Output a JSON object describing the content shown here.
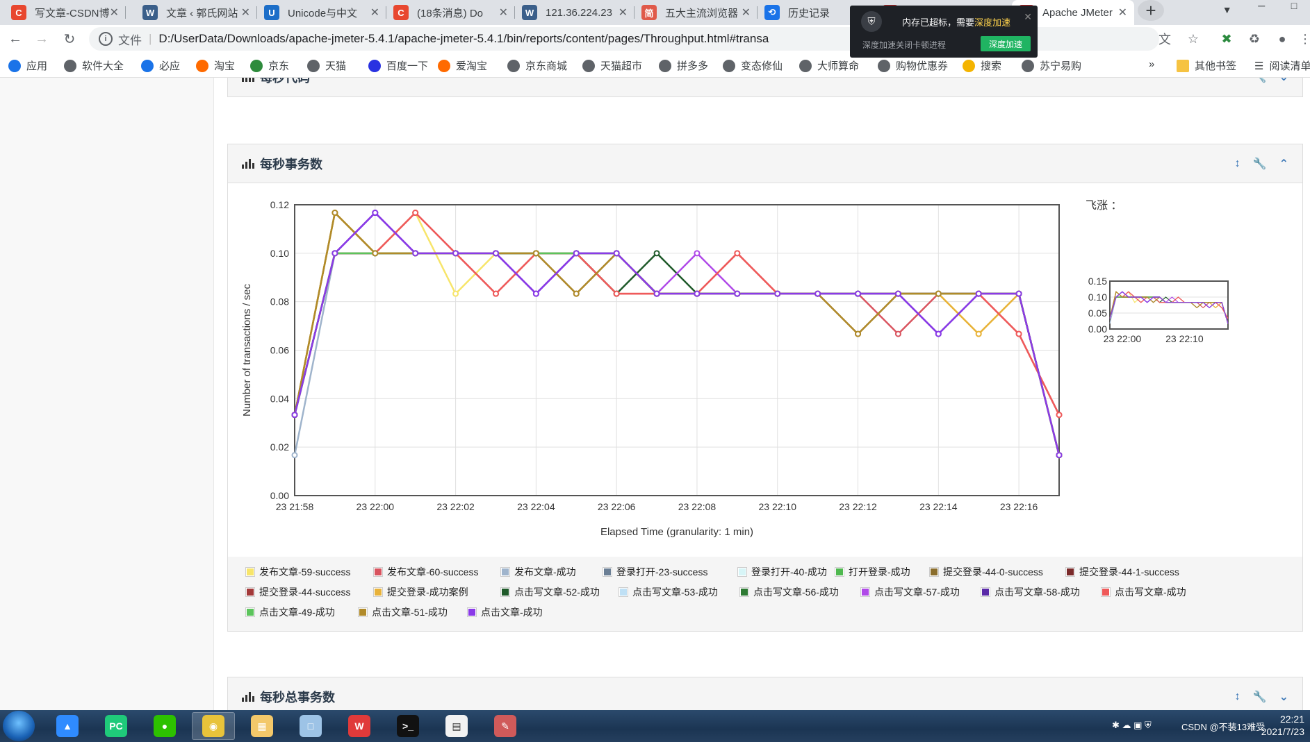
{
  "browser": {
    "tabs": [
      {
        "label": "写文章-CSDN博",
        "favicon": "C",
        "color": "#e8472f"
      },
      {
        "label": "文章 ‹ 郭氏网站",
        "favicon": "W",
        "color": "#3b5f8a"
      },
      {
        "label": "Unicode与中文",
        "favicon": "U",
        "color": "#1c6ec8"
      },
      {
        "label": "(18条消息) Do",
        "favicon": "C",
        "color": "#e8472f"
      },
      {
        "label": "121.36.224.23",
        "favicon": "W",
        "color": "#3b5f8a"
      },
      {
        "label": "五大主流浏览器",
        "favicon": "简",
        "color": "#e05a4a"
      },
      {
        "label": "历史记录",
        "favicon": "⟲",
        "color": "#1a73e8"
      },
      {
        "label": "Apache JMeter",
        "favicon": "/",
        "color": "#b22"
      },
      {
        "label": "Apache JMeter",
        "favicon": "/",
        "color": "#b22"
      }
    ],
    "address": {
      "scheme": "文件",
      "url": "D:/UserData/Downloads/apache-jmeter-5.4.1/apache-jmeter-5.4.1/bin/reports/content/pages/Throughput.html#transa"
    },
    "bookmarks": [
      {
        "label": "应用",
        "color": "#1a73e8"
      },
      {
        "label": "软件大全",
        "color": "#5f6368"
      },
      {
        "label": "必应",
        "color": "#1a73e8"
      },
      {
        "label": "淘宝",
        "color": "#ff6a00"
      },
      {
        "label": "京东",
        "color": "#2e8b3c"
      },
      {
        "label": "天猫",
        "color": "#5f6368"
      },
      {
        "label": "百度一下",
        "color": "#2932e1"
      },
      {
        "label": "爱淘宝",
        "color": "#ff6a00"
      },
      {
        "label": "京东商城",
        "color": "#5f6368"
      },
      {
        "label": "天猫超市",
        "color": "#5f6368"
      },
      {
        "label": "拼多多",
        "color": "#5f6368"
      },
      {
        "label": "变态修仙",
        "color": "#5f6368"
      },
      {
        "label": "大师算命",
        "color": "#5f6368"
      },
      {
        "label": "购物优惠券",
        "color": "#5f6368"
      },
      {
        "label": "搜索",
        "color": "#f4b400"
      },
      {
        "label": "苏宁易购",
        "color": "#5f6368"
      }
    ],
    "bookmarks_more": "»",
    "other_bookmarks": "其他书签",
    "reading_list": "阅读清单"
  },
  "popup": {
    "message": "内存已超标，需要",
    "highlight": "深度加速",
    "subtext": "深度加速关闭卡顿进程",
    "button": "深度加速"
  },
  "page": {
    "top_panel_title": "每秒代码",
    "main_panel_title": "每秒事务数",
    "bottom_panel_title": "每秒总事务数",
    "overview_title": "飞涨 ："
  },
  "chart_data": {
    "type": "line",
    "ylabel": "Number of transactions / sec",
    "xlabel": "Elapsed Time (granularity: 1 min)",
    "ylim": [
      0,
      0.12
    ],
    "yticks": [
      "0.00",
      "0.02",
      "0.04",
      "0.06",
      "0.08",
      "0.10",
      "0.12"
    ],
    "x": [
      "23 21:58",
      "23 21:59",
      "23 22:00",
      "23 22:01",
      "23 22:02",
      "23 22:03",
      "23 22:04",
      "23 22:05",
      "23 22:06",
      "23 22:07",
      "23 22:08",
      "23 22:09",
      "23 22:10",
      "23 22:11",
      "23 22:12",
      "23 22:13",
      "23 22:14",
      "23 22:15",
      "23 22:16",
      "23 22:17"
    ],
    "xticks": [
      "23 21:58",
      "23 22:00",
      "23 22:02",
      "23 22:04",
      "23 22:06",
      "23 22:08",
      "23 22:10",
      "23 22:12",
      "23 22:14",
      "23 22:16"
    ],
    "grid": true,
    "series": [
      {
        "name": "发布文章-59-success",
        "color": "#f7e56a",
        "values": [
          0.0333,
          0.1167,
          0.1,
          0.1167,
          0.0833,
          0.1,
          0.1,
          0.1,
          0.1,
          0.0833,
          0.0833,
          0.0833,
          0.0833,
          0.0833,
          0.0833,
          0.0833,
          0.0833,
          0.0667,
          0.0833,
          0.0167
        ]
      },
      {
        "name": "发布文章-60-success",
        "color": "#d9545f",
        "values": [
          0.0333,
          0.1,
          0.1,
          0.1167,
          0.1,
          0.0833,
          0.1,
          0.1,
          0.0833,
          0.0833,
          0.0833,
          0.1,
          0.0833,
          0.0833,
          0.0833,
          0.0667,
          0.0833,
          0.0833,
          0.0667,
          0.0333
        ]
      },
      {
        "name": "发布文章-成功",
        "color": "#9fb4cc",
        "values": [
          0.0167,
          0.1,
          0.1,
          0.1,
          0.1,
          0.1,
          0.1,
          0.1,
          0.1,
          0.0833,
          0.0833,
          0.0833,
          0.0833,
          0.0833,
          0.0833,
          0.0833,
          0.0833,
          0.0833,
          0.0833,
          0.0167
        ]
      },
      {
        "name": "登录打开-23-success",
        "color": "#6b7f95",
        "values": [
          0.0333,
          0.1,
          0.1,
          0.1,
          0.1,
          0.1,
          0.1,
          0.1,
          0.1,
          0.0833,
          0.0833,
          0.0833,
          0.0833,
          0.0833,
          0.0833,
          0.0833,
          0.0833,
          0.0833,
          0.0833,
          0.0167
        ]
      },
      {
        "name": "登录打开-40-成功",
        "color": "#d7f5f7",
        "values": [
          0.0333,
          0.1,
          0.1,
          0.1,
          0.1,
          0.1,
          0.1,
          0.1,
          0.1,
          0.0833,
          0.0833,
          0.0833,
          0.0833,
          0.0833,
          0.0833,
          0.0833,
          0.0833,
          0.0833,
          0.0833,
          0.0167
        ]
      },
      {
        "name": "打开登录-成功",
        "color": "#4fb84f",
        "values": [
          0.0333,
          0.1,
          0.1,
          0.1,
          0.1,
          0.1,
          0.1,
          0.1,
          0.1,
          0.0833,
          0.0833,
          0.0833,
          0.0833,
          0.0833,
          0.0833,
          0.0833,
          0.0833,
          0.0833,
          0.0833,
          0.0167
        ]
      },
      {
        "name": "提交登录-44-0-success",
        "color": "#8a6d2c",
        "values": [
          0.0333,
          0.1167,
          0.1,
          0.1,
          0.1,
          0.1,
          0.1,
          0.0833,
          0.1,
          0.0833,
          0.0833,
          0.0833,
          0.0833,
          0.0833,
          0.0667,
          0.0833,
          0.0833,
          0.0833,
          0.0833,
          0.0167
        ]
      },
      {
        "name": "提交登录-44-1-success",
        "color": "#7a2a2a",
        "values": [
          0.0333,
          0.1,
          0.1,
          0.1,
          0.1,
          0.1,
          0.1,
          0.1,
          0.1,
          0.0833,
          0.0833,
          0.0833,
          0.0833,
          0.0833,
          0.0833,
          0.0833,
          0.0833,
          0.0833,
          0.0833,
          0.0167
        ]
      },
      {
        "name": "提交登录-44-success",
        "color": "#a33a3a",
        "values": [
          0.0333,
          0.1,
          0.1,
          0.1,
          0.1,
          0.1,
          0.1,
          0.1,
          0.1,
          0.0833,
          0.0833,
          0.0833,
          0.0833,
          0.0833,
          0.0833,
          0.0833,
          0.0833,
          0.0833,
          0.0833,
          0.0167
        ]
      },
      {
        "name": "提交登录-成功案例",
        "color": "#e8b23a",
        "values": [
          0.0333,
          0.1167,
          0.1,
          0.1,
          0.1,
          0.1,
          0.1,
          0.1,
          0.1,
          0.0833,
          0.0833,
          0.0833,
          0.0833,
          0.0833,
          0.0833,
          0.0833,
          0.0833,
          0.0667,
          0.0833,
          0.0167
        ]
      },
      {
        "name": "点击写文章-52-成功",
        "color": "#1f5a2a",
        "values": [
          0.0333,
          0.1,
          0.1,
          0.1,
          0.1,
          0.1,
          0.1,
          0.1,
          0.0833,
          0.1,
          0.0833,
          0.0833,
          0.0833,
          0.0833,
          0.0833,
          0.0833,
          0.0833,
          0.0833,
          0.0833,
          0.0167
        ]
      },
      {
        "name": "点击写文章-53-成功",
        "color": "#bfe0f5",
        "values": [
          0.0333,
          0.1,
          0.1,
          0.1,
          0.1,
          0.1,
          0.1,
          0.1,
          0.1,
          0.0833,
          0.0833,
          0.0833,
          0.0833,
          0.0833,
          0.0833,
          0.0833,
          0.0833,
          0.0833,
          0.0833,
          0.0167
        ]
      },
      {
        "name": "点击写文章-56-成功",
        "color": "#2e7a34",
        "values": [
          0.0333,
          0.1,
          0.1,
          0.1,
          0.1,
          0.1,
          0.1,
          0.1,
          0.1,
          0.0833,
          0.0833,
          0.0833,
          0.0833,
          0.0833,
          0.0833,
          0.0833,
          0.0833,
          0.0833,
          0.0833,
          0.0167
        ]
      },
      {
        "name": "点击写文章-57-成功",
        "color": "#b04ae8",
        "values": [
          0.0333,
          0.1,
          0.1167,
          0.1,
          0.1,
          0.1,
          0.0833,
          0.1,
          0.1,
          0.0833,
          0.1,
          0.0833,
          0.0833,
          0.0833,
          0.0833,
          0.0833,
          0.0833,
          0.0833,
          0.0833,
          0.0167
        ]
      },
      {
        "name": "点击写文章-58-成功",
        "color": "#5a2aa8",
        "values": [
          0.0333,
          0.1,
          0.1167,
          0.1,
          0.1,
          0.1,
          0.0833,
          0.1,
          0.1,
          0.0833,
          0.0833,
          0.0833,
          0.0833,
          0.0833,
          0.0833,
          0.0833,
          0.0667,
          0.0833,
          0.0833,
          0.0167
        ]
      },
      {
        "name": "点击写文章-成功",
        "color": "#ef5a5a",
        "values": [
          0.0333,
          0.1,
          0.1,
          0.1167,
          0.1,
          0.0833,
          0.1,
          0.1,
          0.0833,
          0.0833,
          0.0833,
          0.1,
          0.0833,
          0.0833,
          0.0833,
          0.0833,
          0.0833,
          0.0833,
          0.0667,
          0.0333
        ]
      },
      {
        "name": "点击文章-49-成功",
        "color": "#5cc45c",
        "values": [
          0.0333,
          0.1,
          0.1,
          0.1,
          0.1,
          0.1,
          0.1,
          0.1,
          0.1,
          0.0833,
          0.0833,
          0.0833,
          0.0833,
          0.0833,
          0.0833,
          0.0833,
          0.0833,
          0.0833,
          0.0833,
          0.0167
        ]
      },
      {
        "name": "点击文章-51-成功",
        "color": "#b08a2a",
        "values": [
          0.0333,
          0.1167,
          0.1,
          0.1,
          0.1,
          0.1,
          0.1,
          0.0833,
          0.1,
          0.0833,
          0.0833,
          0.0833,
          0.0833,
          0.0833,
          0.0667,
          0.0833,
          0.0833,
          0.0833,
          0.0833,
          0.0167
        ]
      },
      {
        "name": "点击文章-成功",
        "color": "#8a3ae8",
        "values": [
          0.0333,
          0.1,
          0.1167,
          0.1,
          0.1,
          0.1,
          0.0833,
          0.1,
          0.1,
          0.0833,
          0.0833,
          0.0833,
          0.0833,
          0.0833,
          0.0833,
          0.0833,
          0.0667,
          0.0833,
          0.0833,
          0.0167
        ]
      }
    ]
  },
  "overview_data": {
    "type": "line",
    "ylim": [
      0,
      0.15
    ],
    "yticks": [
      "0.15",
      "0.10",
      "0.05",
      "0.00"
    ],
    "xticks": [
      "23 22:00",
      "23 22:10"
    ]
  },
  "taskbar": {
    "apps": [
      "feishu",
      "pycharm",
      "wechat",
      "chrome",
      "explorer",
      "folder",
      "wps",
      "terminal",
      "notepad",
      "pen"
    ],
    "tray_text": "CSDN @不装13难受",
    "time": "22:21",
    "date": "2021/7/23"
  }
}
